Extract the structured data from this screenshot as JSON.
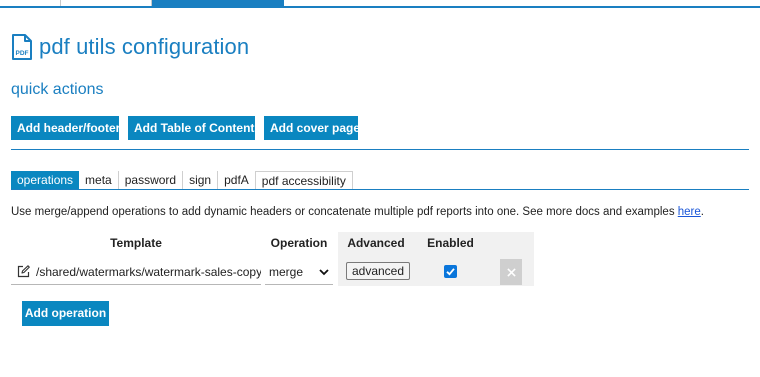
{
  "colors": {
    "accent": "#1a7fc1",
    "button": "#0a87c0",
    "link": "#1a56d8",
    "checkbox": "#0a76db"
  },
  "header": {
    "title": "pdf utils configuration",
    "icon": "pdf-file-icon",
    "icon_text": "PDF"
  },
  "quick_actions": {
    "title": "quick actions",
    "buttons": [
      {
        "label": "Add header/footer"
      },
      {
        "label": "Add Table of Contents"
      },
      {
        "label": "Add cover page"
      }
    ]
  },
  "tabs": [
    {
      "label": "operations",
      "active": true
    },
    {
      "label": "meta"
    },
    {
      "label": "password"
    },
    {
      "label": "sign"
    },
    {
      "label": "pdfA"
    },
    {
      "label": "pdf accessibility"
    }
  ],
  "description": {
    "text": "Use merge/append operations to add dynamic headers or concatenate multiple pdf reports into one. See more docs and examples ",
    "link": "here",
    "suffix": "."
  },
  "table": {
    "columns": [
      "Template",
      "Operation",
      "Advanced",
      "Enabled"
    ],
    "rows": [
      {
        "template": "/shared/watermarks/watermark-sales-copy",
        "operation": "merge",
        "advanced": "advanced",
        "enabled": true,
        "delete_icon": "close-icon"
      }
    ]
  },
  "add_operation": {
    "label": "Add operation"
  }
}
